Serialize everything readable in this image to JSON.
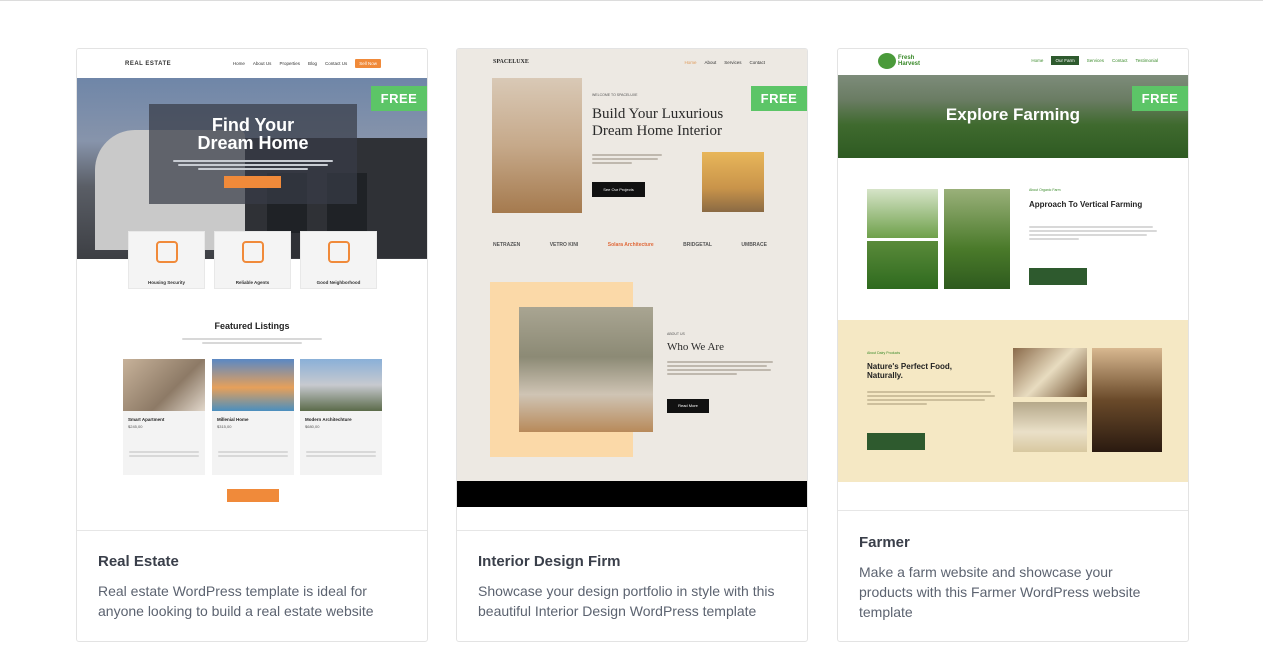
{
  "badge": "FREE",
  "cards": [
    {
      "title": "Real Estate",
      "description": "Real estate WordPress template is ideal for anyone looking to build a real estate website",
      "preview": {
        "logo": "REAL ESTATE",
        "nav": [
          "Home",
          "About Us",
          "Properties",
          "Blog",
          "Contact Us",
          "Sell Now"
        ],
        "hero_line1": "Find Your",
        "hero_line2": "Dream Home",
        "features": [
          "Housing Security",
          "Reliable Agents",
          "Good Neighborhood"
        ],
        "featured_title": "Featured Listings",
        "listings": [
          {
            "name": "Smart Apartment",
            "price": "$245,00"
          },
          {
            "name": "Millenial Home",
            "price": "$315,00"
          },
          {
            "name": "Modern Architechture",
            "price": "$680,00"
          }
        ]
      }
    },
    {
      "title": "Interior Design Firm",
      "description": "Showcase your design portfolio in style with this beautiful Interior Design WordPress template",
      "preview": {
        "logo": "SPACELUXE",
        "nav": [
          "Home",
          "About",
          "Services",
          "Contact"
        ],
        "welcome": "WELCOME TO SPACELUXE",
        "hero": "Build Your Luxurious Dream Home Interior",
        "hero_btn": "See Our Projects",
        "logos": [
          "NETRAZEN",
          "VETRO KINI",
          "Solara Architecture",
          "BRIDGETAL",
          "UMBRACE"
        ],
        "about_label": "ABOUT US",
        "about_title": "Who We Are",
        "about_btn": "Read More"
      }
    },
    {
      "title": "Farmer",
      "description": "Make a farm website and showcase your products with this Farmer WordPress website template",
      "preview": {
        "logo_line1": "Fresh",
        "logo_line2": "Harvest",
        "nav": [
          "Home",
          "Our Farm",
          "Services",
          "Contact",
          "Testimonial"
        ],
        "hero": "Explore Farming",
        "about_label": "About Organic Farm",
        "about_title": "Approach To Vertical Farming",
        "btn": "Discover More",
        "dairy_label": "About Dairy Products",
        "dairy_title": "Nature's Perfect Food, Naturally."
      }
    }
  ]
}
